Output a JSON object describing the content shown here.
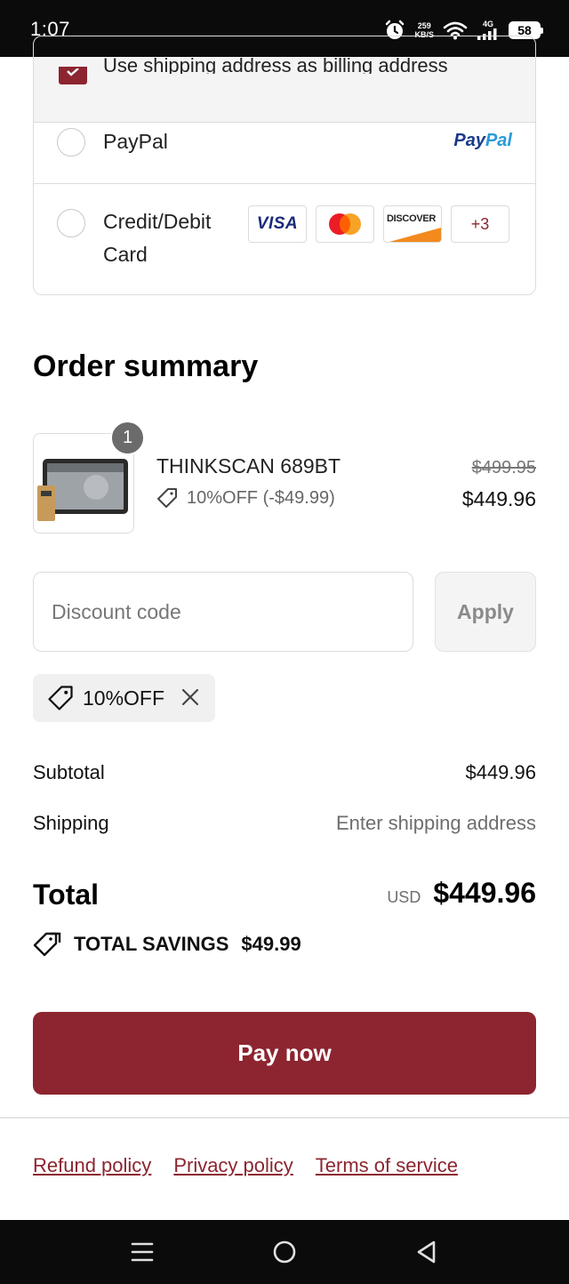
{
  "status_bar": {
    "time": "1:07",
    "speed_value": "259",
    "speed_unit": "KB/S",
    "network": "4G",
    "battery": "58"
  },
  "payment": {
    "billing_label": "Use shipping address as billing address",
    "paypal_label": "PayPal",
    "paypal_logo_part1": "Pay",
    "paypal_logo_part2": "Pal",
    "card_label": "Credit/Debit Card",
    "card_brands": [
      "VISA",
      "DISCOVER",
      "+3"
    ]
  },
  "order_summary": {
    "title": "Order summary",
    "item": {
      "quantity": "1",
      "name": "THINKSCAN 689BT",
      "discount": "10%OFF (-$49.99)",
      "original_price": "$499.95",
      "price": "$449.96"
    },
    "discount_placeholder": "Discount code",
    "apply_label": "Apply",
    "applied_code": "10%OFF",
    "subtotal_label": "Subtotal",
    "subtotal_value": "$449.96",
    "shipping_label": "Shipping",
    "shipping_value": "Enter shipping address",
    "total_label": "Total",
    "total_currency": "USD",
    "total_value": "$449.96",
    "savings_label": "TOTAL SAVINGS",
    "savings_value": "$49.99",
    "pay_label": "Pay now"
  },
  "footer": {
    "links": [
      "Refund policy",
      "Privacy policy",
      "Terms of service"
    ]
  },
  "colors": {
    "brand": "#8c2530",
    "paypal_dark": "#1a3b8a",
    "paypal_light": "#2a9ad8"
  }
}
